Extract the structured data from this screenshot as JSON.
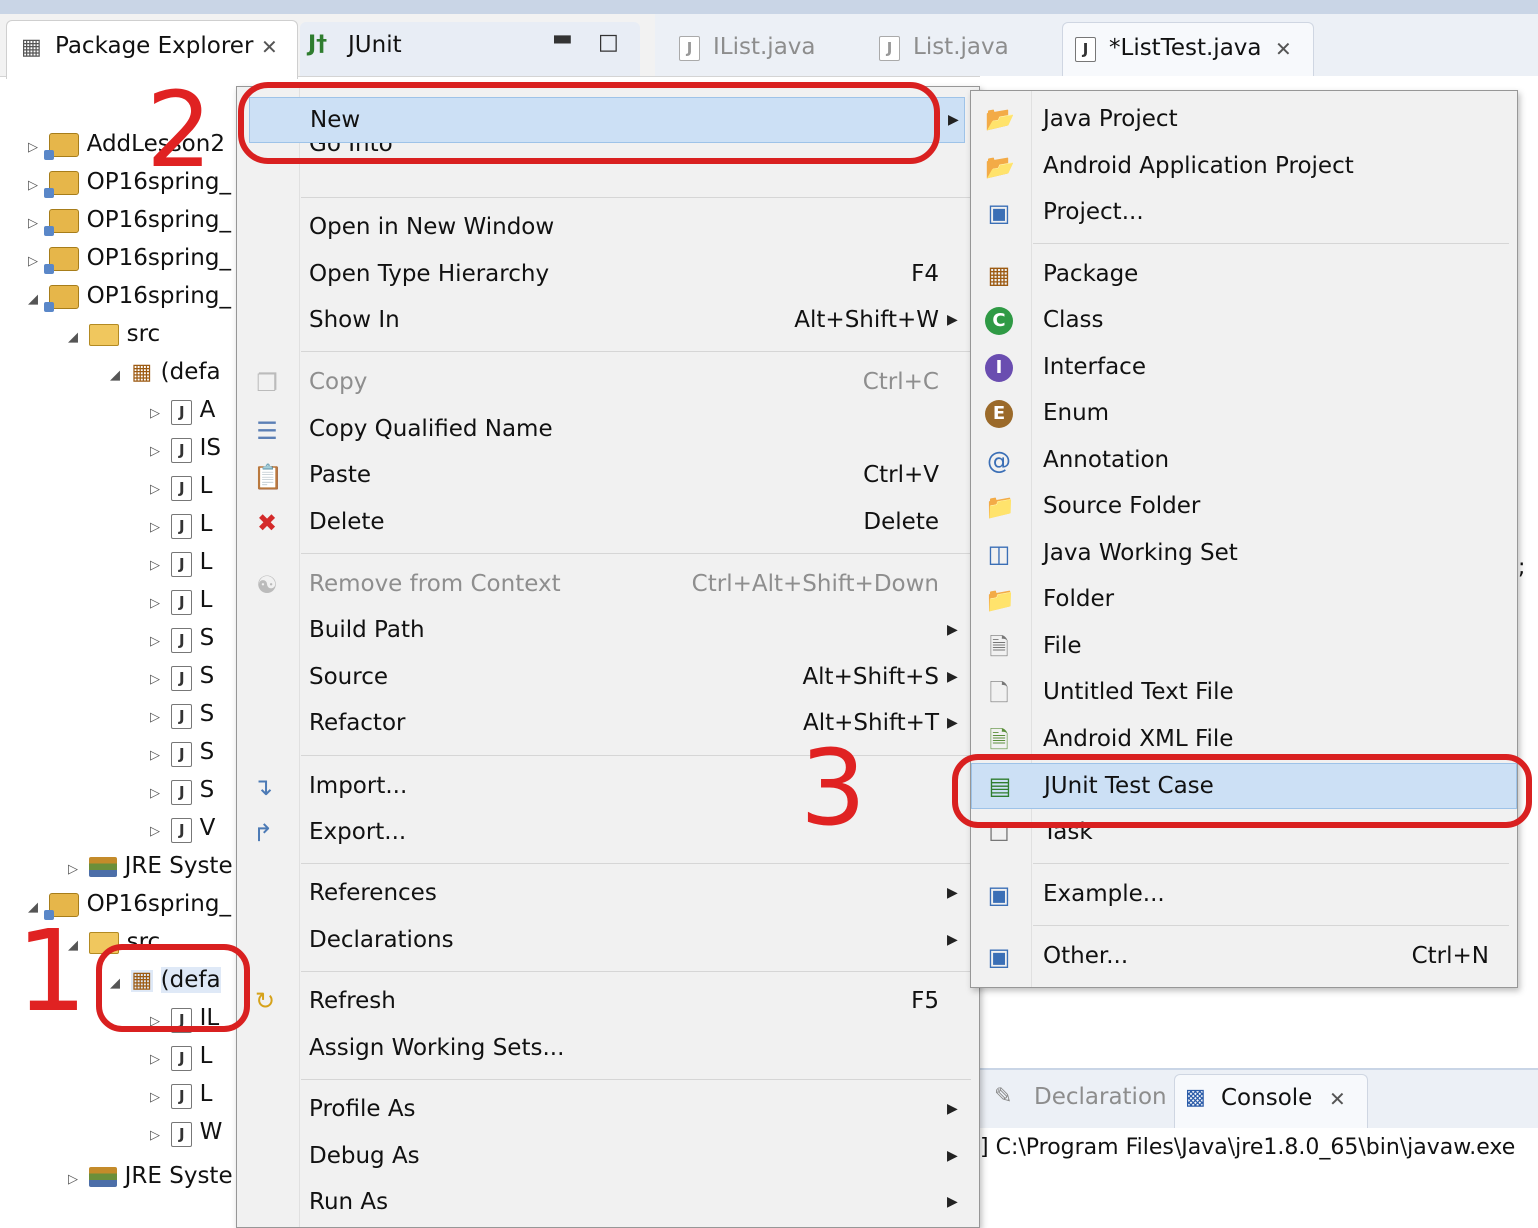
{
  "view_tabs": {
    "package_explorer": "Package Explorer",
    "junit": "JUnit"
  },
  "editor_tabs": [
    {
      "label": "IList.java"
    },
    {
      "label": "List.java"
    },
    {
      "label": "*ListTest.java"
    }
  ],
  "tree": {
    "projects": [
      "AddLesson2",
      "OP16spring_",
      "OP16spring_",
      "OP16spring_",
      "OP16spring_"
    ],
    "src": "src",
    "default_pkg": "(defa",
    "files": [
      "A",
      "IS",
      "L",
      "L",
      "L",
      "L",
      "S",
      "S",
      "S",
      "S",
      "S",
      "V"
    ],
    "jre": "JRE Syste",
    "project2": "OP16spring_",
    "src2": "src",
    "default_pkg2": "(defa",
    "files2": [
      "IL",
      "L",
      "L",
      "W"
    ],
    "jre2": "JRE Syste"
  },
  "context_menu": {
    "items": [
      {
        "label": "New",
        "shortcut": "",
        "submenu": true,
        "highlighted": true
      },
      {
        "label": "Go Into",
        "shortcut": ""
      },
      {
        "label": "Open in New Window",
        "shortcut": ""
      },
      {
        "label": "Open Type Hierarchy",
        "shortcut": "F4"
      },
      {
        "label": "Show In",
        "shortcut": "Alt+Shift+W",
        "submenu": true
      },
      {
        "label": "Copy",
        "shortcut": "Ctrl+C",
        "disabled": true
      },
      {
        "label": "Copy Qualified Name",
        "shortcut": ""
      },
      {
        "label": "Paste",
        "shortcut": "Ctrl+V"
      },
      {
        "label": "Delete",
        "shortcut": "Delete"
      },
      {
        "label": "Remove from Context",
        "shortcut": "Ctrl+Alt+Shift+Down",
        "disabled": true
      },
      {
        "label": "Build Path",
        "shortcut": "",
        "submenu": true
      },
      {
        "label": "Source",
        "shortcut": "Alt+Shift+S",
        "submenu": true
      },
      {
        "label": "Refactor",
        "shortcut": "Alt+Shift+T",
        "submenu": true
      },
      {
        "label": "Import...",
        "shortcut": ""
      },
      {
        "label": "Export...",
        "shortcut": ""
      },
      {
        "label": "References",
        "shortcut": "",
        "submenu": true
      },
      {
        "label": "Declarations",
        "shortcut": "",
        "submenu": true
      },
      {
        "label": "Refresh",
        "shortcut": "F5"
      },
      {
        "label": "Assign Working Sets...",
        "shortcut": ""
      },
      {
        "label": "Profile As",
        "shortcut": "",
        "submenu": true
      },
      {
        "label": "Debug As",
        "shortcut": "",
        "submenu": true
      },
      {
        "label": "Run As",
        "shortcut": "",
        "submenu": true
      }
    ]
  },
  "new_submenu": {
    "items": [
      {
        "label": "Java Project",
        "icon": "java-project-icon"
      },
      {
        "label": "Android Application Project",
        "icon": "android-project-icon"
      },
      {
        "label": "Project...",
        "icon": "project-icon"
      },
      {
        "label": "Package",
        "icon": "package-icon"
      },
      {
        "label": "Class",
        "icon": "class-icon"
      },
      {
        "label": "Interface",
        "icon": "interface-icon"
      },
      {
        "label": "Enum",
        "icon": "enum-icon"
      },
      {
        "label": "Annotation",
        "icon": "annotation-icon"
      },
      {
        "label": "Source Folder",
        "icon": "source-folder-icon"
      },
      {
        "label": "Java Working Set",
        "icon": "working-set-icon"
      },
      {
        "label": "Folder",
        "icon": "folder-icon"
      },
      {
        "label": "File",
        "icon": "file-icon"
      },
      {
        "label": "Untitled Text File",
        "icon": "text-file-icon"
      },
      {
        "label": "Android XML File",
        "icon": "android-xml-icon"
      },
      {
        "label": "JUnit Test Case",
        "icon": "junit-test-case-icon",
        "highlighted": true
      },
      {
        "label": "Task",
        "icon": "task-icon"
      },
      {
        "label": "Example...",
        "icon": "example-icon"
      },
      {
        "label": "Other...",
        "icon": "other-icon",
        "shortcut": "Ctrl+N"
      }
    ]
  },
  "bottom_tabs": {
    "declaration": "Declaration",
    "console": "Console"
  },
  "console_text": "] C:\\Program Files\\Java\\jre1.8.0_65\\bin\\javaw.exe",
  "annotations": {
    "step1": "1",
    "step2": "2",
    "step3": "3"
  },
  "colors": {
    "highlight": "#cce0f5",
    "annotation_red": "#d92020",
    "menu_bg": "#f1f1f1"
  }
}
